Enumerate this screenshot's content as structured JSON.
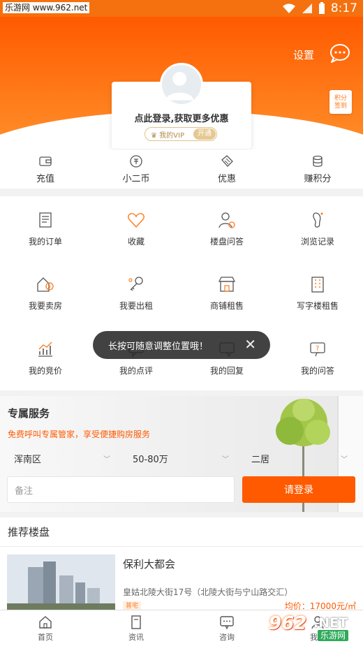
{
  "statusbar": {
    "watermark": "乐游网 www.962.net",
    "time": "8:17"
  },
  "header": {
    "settings_label": "设置",
    "checkin_line1": "积分",
    "checkin_line2": "签到"
  },
  "login_card": {
    "title": "点此登录,获取更多优惠",
    "vip_label": "我的VIP",
    "vip_open": "开通"
  },
  "quick_row": [
    {
      "label": "充值",
      "icon": "wallet-icon"
    },
    {
      "label": "小二币",
      "icon": "coin-icon"
    },
    {
      "label": "优惠",
      "icon": "coupon-icon"
    },
    {
      "label": "赚积分",
      "icon": "points-stack-icon"
    }
  ],
  "grid": [
    {
      "label": "我的订单",
      "icon": "order-icon"
    },
    {
      "label": "收藏",
      "icon": "heart-icon"
    },
    {
      "label": "楼盘问答",
      "icon": "qa-person-icon"
    },
    {
      "label": "浏览记录",
      "icon": "footprint-icon"
    },
    {
      "label": "我要卖房",
      "icon": "sell-house-icon"
    },
    {
      "label": "我要出租",
      "icon": "rent-key-icon"
    },
    {
      "label": "商铺租售",
      "icon": "shop-icon"
    },
    {
      "label": "写字楼租售",
      "icon": "office-building-icon"
    },
    {
      "label": "我的竞价",
      "icon": "bid-chart-icon"
    },
    {
      "label": "我的点评",
      "icon": "comment-icon"
    },
    {
      "label": "我的回复",
      "icon": "reply-icon"
    },
    {
      "label": "我的问答",
      "icon": "question-icon"
    }
  ],
  "toast": {
    "text": "长按可随意调整位置哦！"
  },
  "service": {
    "title": "专属服务",
    "subtitle": "免费呼叫专属管家，享受便捷购房服务",
    "selects": [
      "浑南区",
      "50-80万",
      "二居"
    ],
    "remark_placeholder": "备注",
    "login_button": "请登录"
  },
  "recommend": {
    "heading": "推荐楼盘",
    "listing": {
      "name": "保利大都会",
      "address": "皇姑北陵大街17号（北陵大街与宁山路交汇）",
      "tag": "普宅",
      "price": "均价：17000元/㎡"
    }
  },
  "bottom_nav": [
    {
      "label": "首页",
      "icon": "home-icon"
    },
    {
      "label": "资讯",
      "icon": "news-icon"
    },
    {
      "label": "咨询",
      "icon": "chat-icon"
    },
    {
      "label": "我的",
      "icon": "user-icon"
    }
  ],
  "logo": {
    "num": "962",
    "net": ".NET",
    "cn": "乐游网"
  },
  "colors": {
    "accent": "#ff5a00",
    "gold": "#e6c891"
  }
}
